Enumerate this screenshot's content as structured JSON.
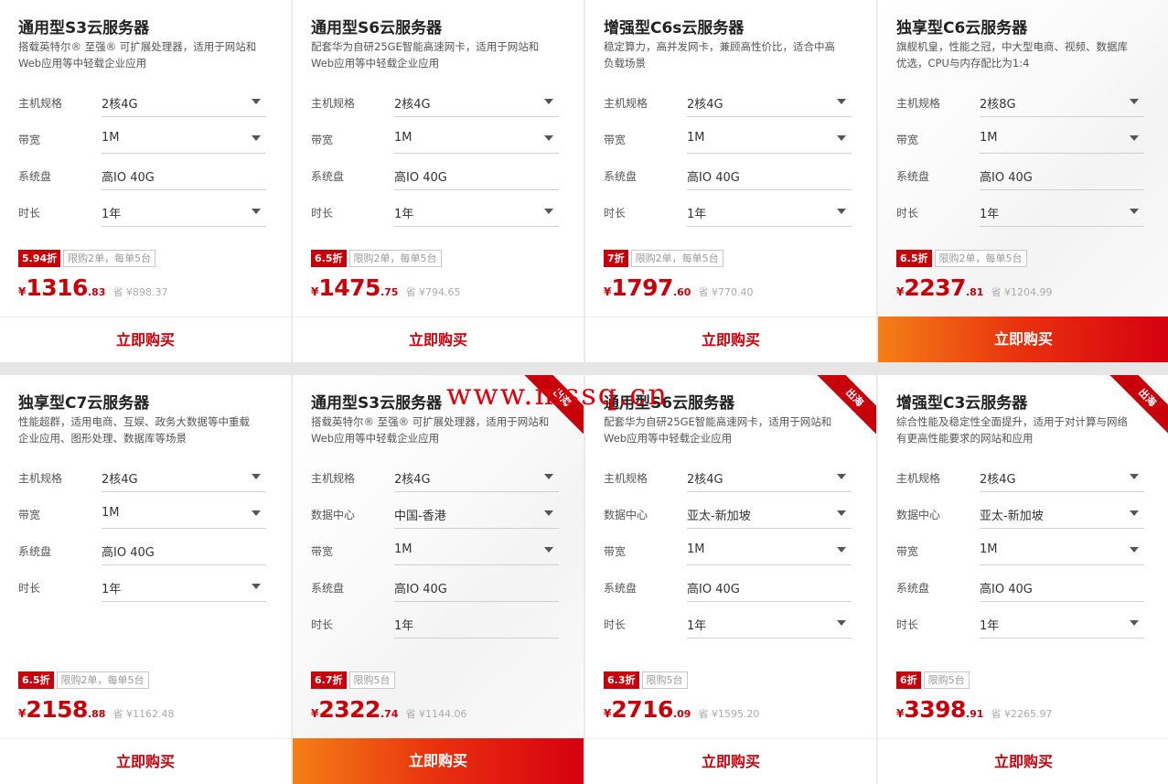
{
  "watermark": "www.mssq.cn",
  "buy_label": "立即购买",
  "cards": [
    {
      "title": "通用型S3云服务器",
      "desc": "搭载英特尔® 至强® 可扩展处理器，适用于网站和Web应用等中轻载企业应用",
      "specs": [
        {
          "label": "主机规格",
          "value": "2核4G",
          "dropdown": true
        },
        {
          "label": "带宽",
          "value": "1M",
          "dropdown": true
        },
        {
          "label": "系统盘",
          "value": "高IO 40G",
          "dropdown": false
        },
        {
          "label": "时长",
          "value": "1年",
          "dropdown": true
        }
      ],
      "discount": "5.94折",
      "limit": "限购2单，每单5台",
      "currency": "¥",
      "price_int": "1316",
      "price_dec": ".83",
      "save": "省 ¥898.37",
      "hot": false,
      "ribbon": ""
    },
    {
      "title": "通用型S6云服务器",
      "desc": "配套华为自研25GE智能高速网卡，适用于网站和Web应用等中轻载企业应用",
      "specs": [
        {
          "label": "主机规格",
          "value": "2核4G",
          "dropdown": true
        },
        {
          "label": "带宽",
          "value": "1M",
          "dropdown": true
        },
        {
          "label": "系统盘",
          "value": "高IO 40G",
          "dropdown": false
        },
        {
          "label": "时长",
          "value": "1年",
          "dropdown": true
        }
      ],
      "discount": "6.5折",
      "limit": "限购2单，每单5台",
      "currency": "¥",
      "price_int": "1475",
      "price_dec": ".75",
      "save": "省 ¥794.65",
      "hot": false,
      "ribbon": ""
    },
    {
      "title": "增强型C6s云服务器",
      "desc": "稳定算力，高并发网卡，兼顾高性价比，适合中高负载场景",
      "specs": [
        {
          "label": "主机规格",
          "value": "2核4G",
          "dropdown": true
        },
        {
          "label": "带宽",
          "value": "1M",
          "dropdown": true
        },
        {
          "label": "系统盘",
          "value": "高IO 40G",
          "dropdown": false
        },
        {
          "label": "时长",
          "value": "1年",
          "dropdown": true
        }
      ],
      "discount": "7折",
      "limit": "限购2单，每单5台",
      "currency": "¥",
      "price_int": "1797",
      "price_dec": ".60",
      "save": "省 ¥770.40",
      "hot": false,
      "ribbon": ""
    },
    {
      "title": "独享型C6云服务器",
      "desc": "旗舰机皇，性能之冠，中大型电商、视频、数据库优选，CPU与内存配比为1:4",
      "specs": [
        {
          "label": "主机规格",
          "value": "2核8G",
          "dropdown": true
        },
        {
          "label": "带宽",
          "value": "1M",
          "dropdown": true
        },
        {
          "label": "系统盘",
          "value": "高IO 40G",
          "dropdown": false
        },
        {
          "label": "时长",
          "value": "1年",
          "dropdown": true
        }
      ],
      "discount": "6.5折",
      "limit": "限购2单，每单5台",
      "currency": "¥",
      "price_int": "2237",
      "price_dec": ".81",
      "save": "省 ¥1204.99",
      "hot": true,
      "ribbon": ""
    },
    {
      "title": "独享型C7云服务器",
      "desc": "性能超群，适用电商、互娱、政务大数据等中重载企业应用、图形处理、数据库等场景",
      "specs": [
        {
          "label": "主机规格",
          "value": "2核4G",
          "dropdown": true
        },
        {
          "label": "带宽",
          "value": "1M",
          "dropdown": true
        },
        {
          "label": "系统盘",
          "value": "高IO 40G",
          "dropdown": false
        },
        {
          "label": "时长",
          "value": "1年",
          "dropdown": true
        }
      ],
      "discount": "6.5折",
      "limit": "限购2单，每单5台",
      "currency": "¥",
      "price_int": "2158",
      "price_dec": ".88",
      "save": "省 ¥1162.48",
      "hot": false,
      "ribbon": ""
    },
    {
      "title": "通用型S3云服务器",
      "desc": "搭载英特尔® 至强® 可扩展处理器，适用于网站和Web应用等中轻载企业应用",
      "specs": [
        {
          "label": "主机规格",
          "value": "2核4G",
          "dropdown": true
        },
        {
          "label": "数据中心",
          "value": "中国-香港",
          "dropdown": true
        },
        {
          "label": "带宽",
          "value": "1M",
          "dropdown": true
        },
        {
          "label": "系统盘",
          "value": "高IO 40G",
          "dropdown": false
        },
        {
          "label": "时长",
          "value": "1年",
          "dropdown": false
        }
      ],
      "discount": "6.7折",
      "limit": "限购5台",
      "currency": "¥",
      "price_int": "2322",
      "price_dec": ".74",
      "save": "省 ¥1144.06",
      "hot": true,
      "ribbon": "出海"
    },
    {
      "title": "通用型S6云服务器",
      "desc": "配套华为自研25GE智能高速网卡，适用于网站和Web应用等中轻载企业应用",
      "specs": [
        {
          "label": "主机规格",
          "value": "2核4G",
          "dropdown": true
        },
        {
          "label": "数据中心",
          "value": "亚太-新加坡",
          "dropdown": true
        },
        {
          "label": "带宽",
          "value": "1M",
          "dropdown": true
        },
        {
          "label": "系统盘",
          "value": "高IO 40G",
          "dropdown": false
        },
        {
          "label": "时长",
          "value": "1年",
          "dropdown": true
        }
      ],
      "discount": "6.3折",
      "limit": "限购5台",
      "currency": "¥",
      "price_int": "2716",
      "price_dec": ".09",
      "save": "省 ¥1595.20",
      "hot": false,
      "ribbon": "出海"
    },
    {
      "title": "增强型C3云服务器",
      "desc": "综合性能及稳定性全面提升，适用于对计算与网络有更高性能要求的网站和应用",
      "specs": [
        {
          "label": "主机规格",
          "value": "2核4G",
          "dropdown": true
        },
        {
          "label": "数据中心",
          "value": "亚太-新加坡",
          "dropdown": true
        },
        {
          "label": "带宽",
          "value": "1M",
          "dropdown": true
        },
        {
          "label": "系统盘",
          "value": "高IO 40G",
          "dropdown": false
        },
        {
          "label": "时长",
          "value": "1年",
          "dropdown": true
        }
      ],
      "discount": "6折",
      "limit": "限购5台",
      "currency": "¥",
      "price_int": "3398",
      "price_dec": ".91",
      "save": "省 ¥2265.97",
      "hot": false,
      "ribbon": "出海"
    }
  ]
}
